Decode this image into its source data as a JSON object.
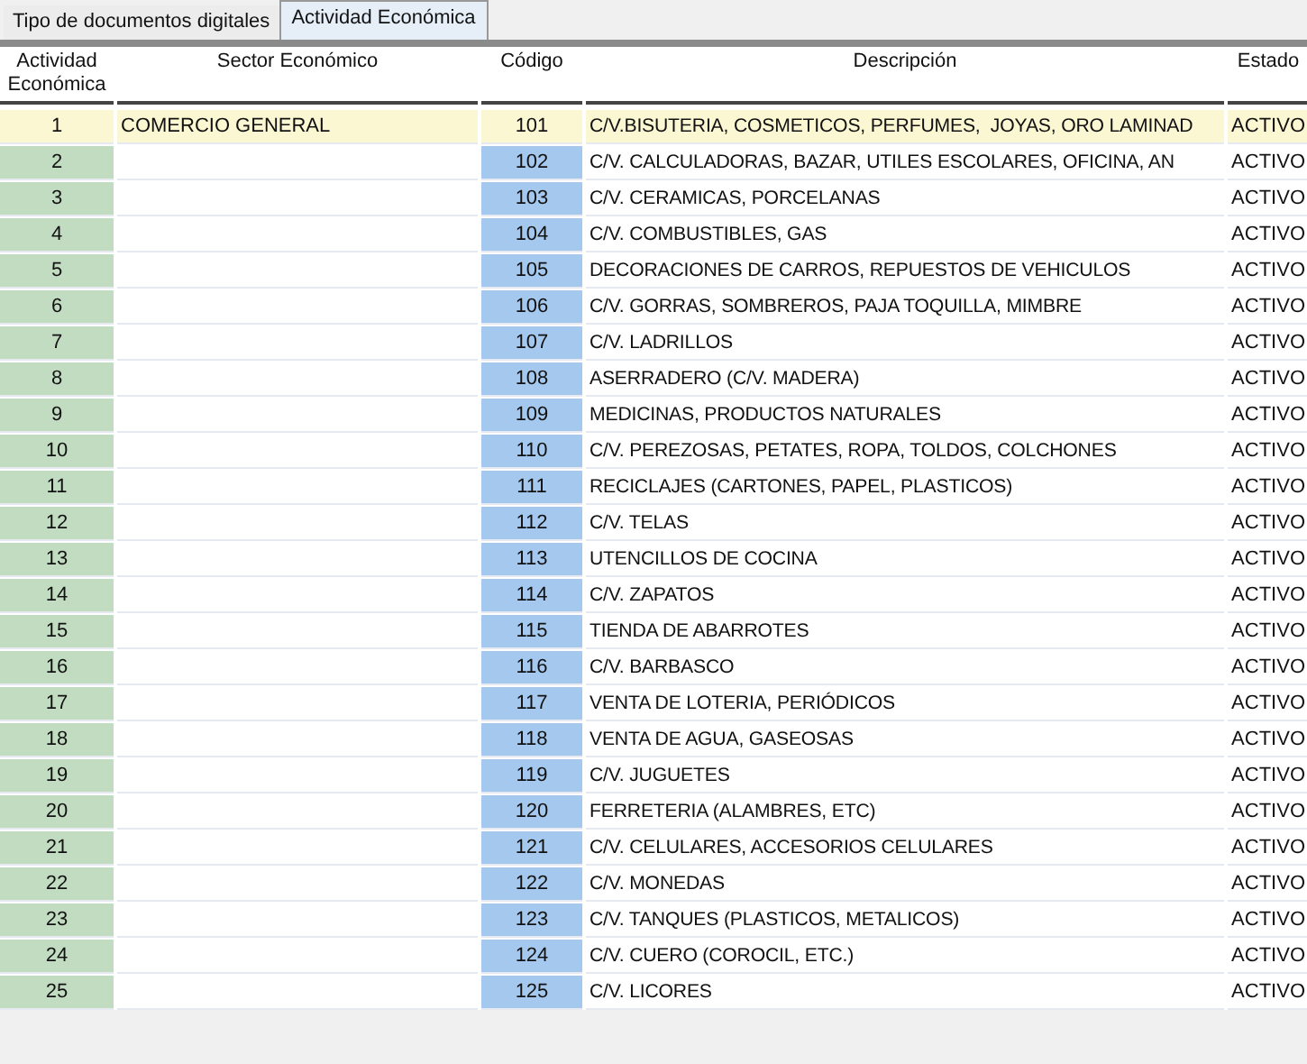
{
  "tabs": [
    {
      "label": "Tipo de documentos digitales",
      "selected": false
    },
    {
      "label": "Actividad Económica",
      "selected": true
    }
  ],
  "table": {
    "columns": [
      "Actividad Económica",
      "Sector Económico",
      "Código",
      "Descripción",
      "Estado"
    ],
    "rows": [
      {
        "actividad": "1",
        "sector": "COMERCIO GENERAL",
        "codigo": "101",
        "descripcion": "C/V.BISUTERIA, COSMETICOS, PERFUMES,  JOYAS, ORO LAMINAD",
        "estado": "ACTIVO",
        "selected": true
      },
      {
        "actividad": "2",
        "codigo": "102",
        "descripcion": "C/V. CALCULADORAS, BAZAR, UTILES ESCOLARES, OFICINA, AN",
        "estado": "ACTIVO",
        "selected": false
      },
      {
        "actividad": "3",
        "codigo": "103",
        "descripcion": "C/V. CERAMICAS, PORCELANAS",
        "estado": "ACTIVO",
        "selected": false
      },
      {
        "actividad": "4",
        "codigo": "104",
        "descripcion": "C/V. COMBUSTIBLES, GAS",
        "estado": "ACTIVO",
        "selected": false
      },
      {
        "actividad": "5",
        "codigo": "105",
        "descripcion": "DECORACIONES DE CARROS, REPUESTOS DE VEHICULOS",
        "estado": "ACTIVO",
        "selected": false
      },
      {
        "actividad": "6",
        "codigo": "106",
        "descripcion": "C/V. GORRAS, SOMBREROS, PAJA TOQUILLA, MIMBRE",
        "estado": "ACTIVO",
        "selected": false
      },
      {
        "actividad": "7",
        "codigo": "107",
        "descripcion": "C/V. LADRILLOS",
        "estado": "ACTIVO",
        "selected": false
      },
      {
        "actividad": "8",
        "codigo": "108",
        "descripcion": "ASERRADERO (C/V. MADERA)",
        "estado": "ACTIVO",
        "selected": false
      },
      {
        "actividad": "9",
        "codigo": "109",
        "descripcion": "MEDICINAS, PRODUCTOS NATURALES",
        "estado": "ACTIVO",
        "selected": false
      },
      {
        "actividad": "10",
        "codigo": "110",
        "descripcion": "C/V. PEREZOSAS, PETATES, ROPA, TOLDOS, COLCHONES",
        "estado": "ACTIVO",
        "selected": false
      },
      {
        "actividad": "11",
        "codigo": "111",
        "descripcion": "RECICLAJES (CARTONES, PAPEL, PLASTICOS)",
        "estado": "ACTIVO",
        "selected": false
      },
      {
        "actividad": "12",
        "codigo": "112",
        "descripcion": "C/V. TELAS",
        "estado": "ACTIVO",
        "selected": false
      },
      {
        "actividad": "13",
        "codigo": "113",
        "descripcion": "UTENCILLOS DE COCINA",
        "estado": "ACTIVO",
        "selected": false
      },
      {
        "actividad": "14",
        "codigo": "114",
        "descripcion": "C/V. ZAPATOS",
        "estado": "ACTIVO",
        "selected": false
      },
      {
        "actividad": "15",
        "codigo": "115",
        "descripcion": "TIENDA DE ABARROTES",
        "estado": "ACTIVO",
        "selected": false
      },
      {
        "actividad": "16",
        "codigo": "116",
        "descripcion": "C/V. BARBASCO",
        "estado": "ACTIVO",
        "selected": false
      },
      {
        "actividad": "17",
        "codigo": "117",
        "descripcion": "VENTA DE LOTERIA, PERIÓDICOS",
        "estado": "ACTIVO",
        "selected": false
      },
      {
        "actividad": "18",
        "codigo": "118",
        "descripcion": "VENTA DE AGUA, GASEOSAS",
        "estado": "ACTIVO",
        "selected": false
      },
      {
        "actividad": "19",
        "codigo": "119",
        "descripcion": "C/V. JUGUETES",
        "estado": "ACTIVO",
        "selected": false
      },
      {
        "actividad": "20",
        "codigo": "120",
        "descripcion": "FERRETERIA (ALAMBRES, ETC)",
        "estado": "ACTIVO",
        "selected": false
      },
      {
        "actividad": "21",
        "codigo": "121",
        "descripcion": "C/V. CELULARES, ACCESORIOS CELULARES",
        "estado": "ACTIVO",
        "selected": false
      },
      {
        "actividad": "22",
        "codigo": "122",
        "descripcion": "C/V. MONEDAS",
        "estado": "ACTIVO",
        "selected": false
      },
      {
        "actividad": "23",
        "codigo": "123",
        "descripcion": "C/V. TANQUES (PLASTICOS, METALICOS)",
        "estado": "ACTIVO",
        "selected": false
      },
      {
        "actividad": "24",
        "codigo": "124",
        "descripcion": "C/V. CUERO (COROCIL, ETC.)",
        "estado": "ACTIVO",
        "selected": false
      },
      {
        "actividad": "25",
        "codigo": "125",
        "descripcion": "C/V. LICORES",
        "estado": "ACTIVO",
        "selected": false
      }
    ]
  }
}
